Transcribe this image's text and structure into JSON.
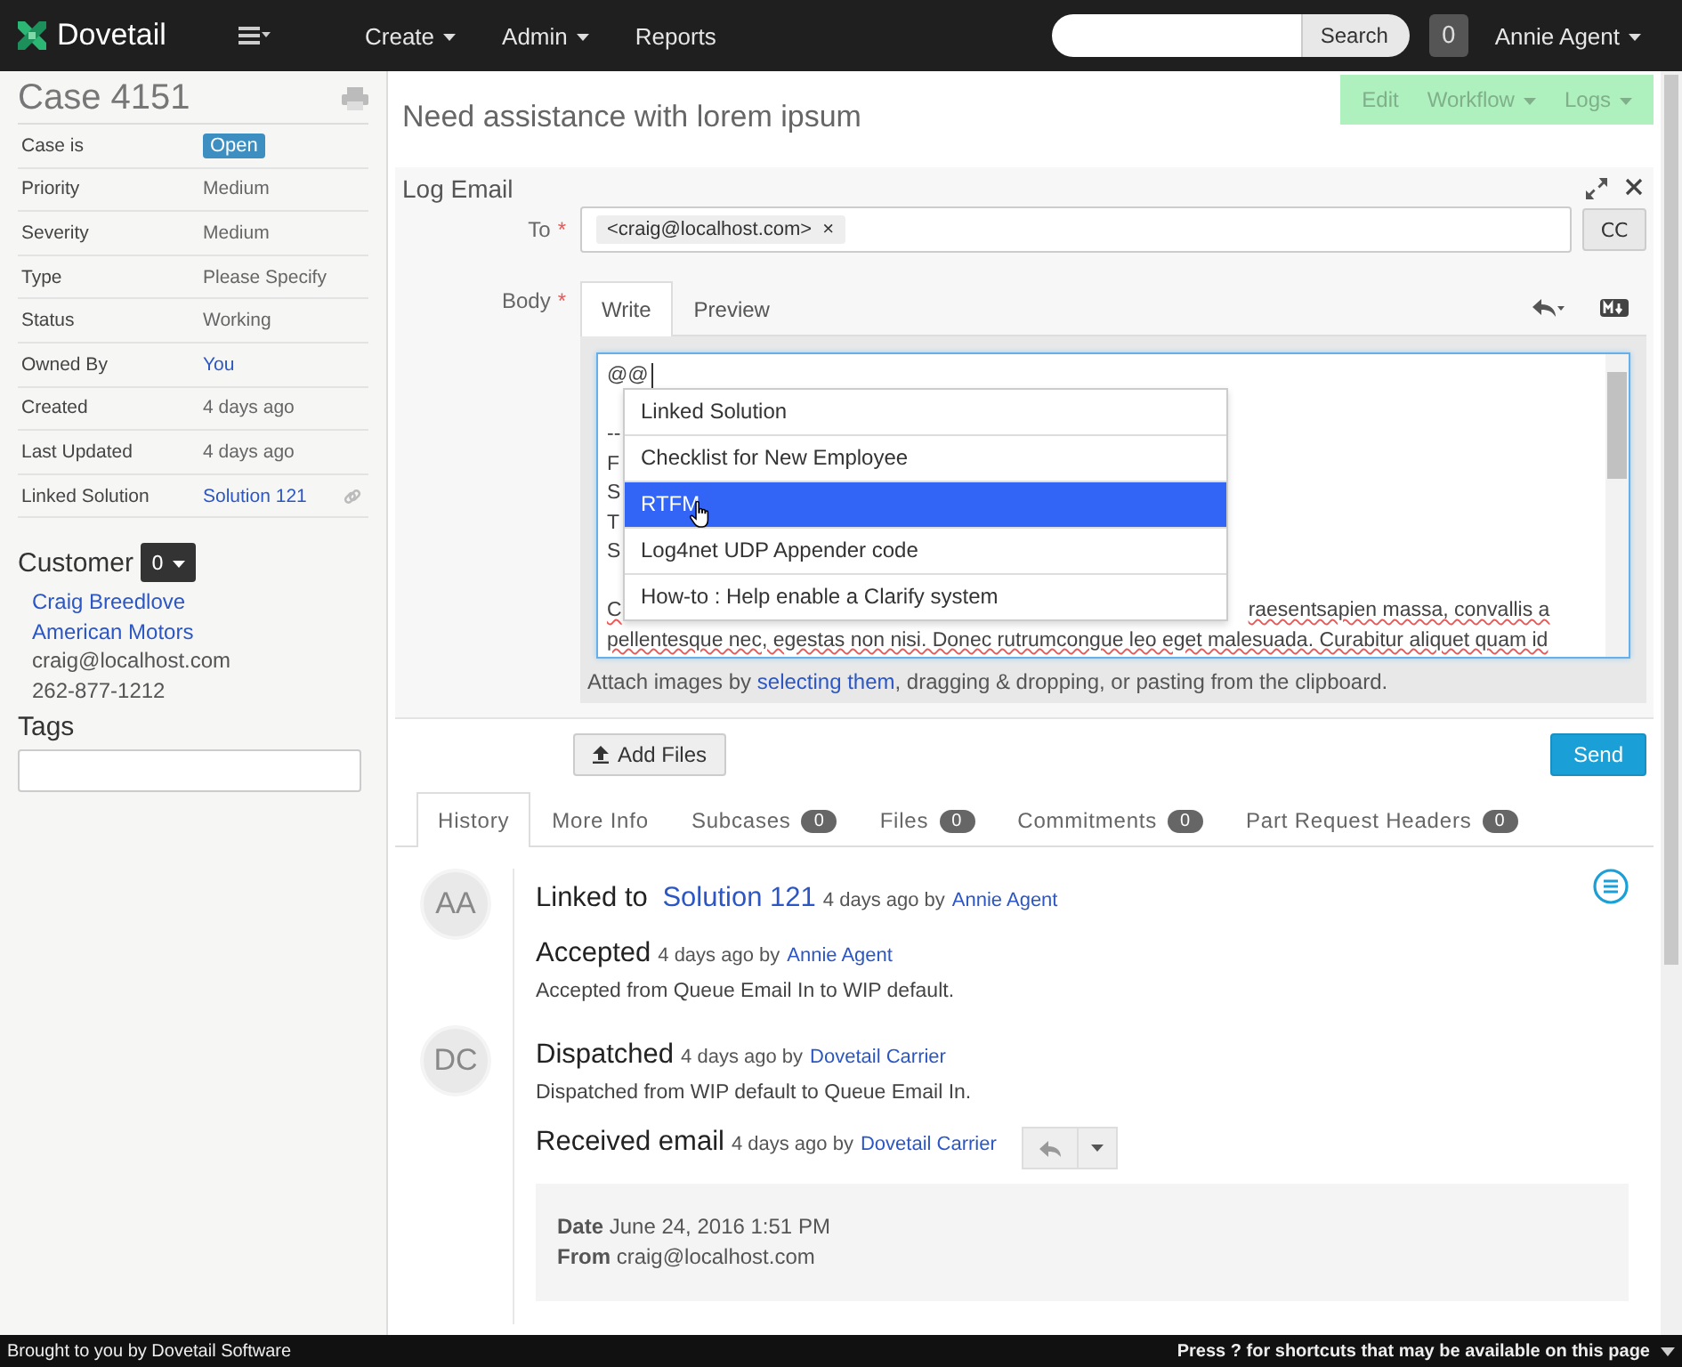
{
  "navbar": {
    "brand": "Dovetail",
    "menu": [
      {
        "label": "Create",
        "dropdown": true
      },
      {
        "label": "Admin",
        "dropdown": true
      },
      {
        "label": "Reports",
        "dropdown": false
      }
    ],
    "search_button": "Search",
    "notification_count": "0",
    "user": "Annie Agent"
  },
  "sidebar": {
    "title": "Case 4151",
    "fields": [
      {
        "label": "Case is",
        "value": "Open",
        "kind": "badge"
      },
      {
        "label": "Priority",
        "value": "Medium",
        "kind": "text"
      },
      {
        "label": "Severity",
        "value": "Medium",
        "kind": "text"
      },
      {
        "label": "Type",
        "value": "Please Specify",
        "kind": "text"
      },
      {
        "label": "Status",
        "value": "Working",
        "kind": "text"
      },
      {
        "label": "Owned By",
        "value": "You",
        "kind": "link"
      },
      {
        "label": "Created",
        "value": "4 days ago",
        "kind": "text"
      },
      {
        "label": "Last Updated",
        "value": "4 days ago",
        "kind": "text"
      },
      {
        "label": "Linked Solution",
        "value": "Solution 121",
        "kind": "linked"
      }
    ],
    "customer": {
      "heading": "Customer",
      "count": "0",
      "lines": [
        {
          "text": "Craig Breedlove",
          "kind": "link"
        },
        {
          "text": "American Motors",
          "kind": "link"
        },
        {
          "text": "craig@localhost.com",
          "kind": "text"
        },
        {
          "text": "262-877-1212",
          "kind": "text"
        }
      ]
    },
    "tags_heading": "Tags"
  },
  "case_title": "Need assistance with lorem ipsum",
  "actions": [
    {
      "label": "Edit",
      "dropdown": false
    },
    {
      "label": "Workflow",
      "dropdown": true
    },
    {
      "label": "Logs",
      "dropdown": true
    }
  ],
  "log_email": {
    "title": "Log Email",
    "to": {
      "label": "To",
      "required_mark": "*",
      "recipients": [
        "<craig@localhost.com>"
      ],
      "remove": "×"
    },
    "cc_button": "CC",
    "body": {
      "label": "Body",
      "required_mark": "*"
    },
    "editor_tabs": [
      {
        "label": "Write",
        "selected": true
      },
      {
        "label": "Preview",
        "selected": false
      }
    ],
    "body_lines": [
      {
        "start": "@@",
        "cursor": true
      },
      {
        "start": "--",
        "blank_before": true
      },
      {
        "start": "F"
      },
      {
        "start": "S"
      },
      {
        "start": "T"
      },
      {
        "start": "S"
      },
      {
        "start": "C",
        "end": "raesentsapien massa, convallis a",
        "blank_before": true
      },
      {
        "start": "pellentesque nec, egestas non nisi. Donec rutrumcongue leo eget malesuada. Curabitur aliquet quam id"
      }
    ],
    "suggestions": [
      {
        "label": "Linked Solution",
        "selected": false
      },
      {
        "label": "Checklist for New Employee",
        "selected": false
      },
      {
        "label": "RTFM",
        "selected": true
      },
      {
        "label": "Log4net UDP Appender code",
        "selected": false
      },
      {
        "label": "How-to : Help enable a Clarify system",
        "selected": false
      }
    ],
    "attach_before": "Attach images by ",
    "attach_link": "selecting them",
    "attach_after": ", dragging & dropping, or pasting from the clipboard.",
    "add_files_button": "Add Files",
    "send_button": "Send"
  },
  "detail_tabs": [
    {
      "label": "History",
      "selected": true
    },
    {
      "label": "More Info",
      "selected": false
    },
    {
      "label": "Subcases",
      "count": "0",
      "selected": false
    },
    {
      "label": "Files",
      "count": "0",
      "selected": false
    },
    {
      "label": "Commitments",
      "count": "0",
      "selected": false
    },
    {
      "label": "Part Request Headers",
      "count": "0",
      "selected": false
    }
  ],
  "history": [
    {
      "avatar": "AA",
      "entries": [
        {
          "kind": "linked",
          "title": "Linked to ",
          "link": "Solution 121",
          "meta": "4 days ago by",
          "author": "Annie Agent"
        },
        {
          "kind": "event",
          "title": "Accepted",
          "meta": "4 days ago by",
          "author": "Annie Agent",
          "description": "Accepted from Queue Email In to WIP default."
        }
      ]
    },
    {
      "avatar": "DC",
      "entries": [
        {
          "kind": "event",
          "title": "Dispatched",
          "meta": "4 days ago by",
          "author": "Dovetail Carrier",
          "description": "Dispatched from WIP default to Queue Email In."
        },
        {
          "kind": "email",
          "title": "Received email",
          "meta": "4 days ago by",
          "author": "Dovetail Carrier",
          "details": [
            {
              "label": "Date",
              "value": "June 24, 2016 1:51 PM"
            },
            {
              "label": "From",
              "value": "craig@localhost.com"
            }
          ]
        }
      ]
    }
  ],
  "footer": {
    "left": "Brought to you by Dovetail Software",
    "right": "Press ? for shortcuts that may be available on this page"
  }
}
